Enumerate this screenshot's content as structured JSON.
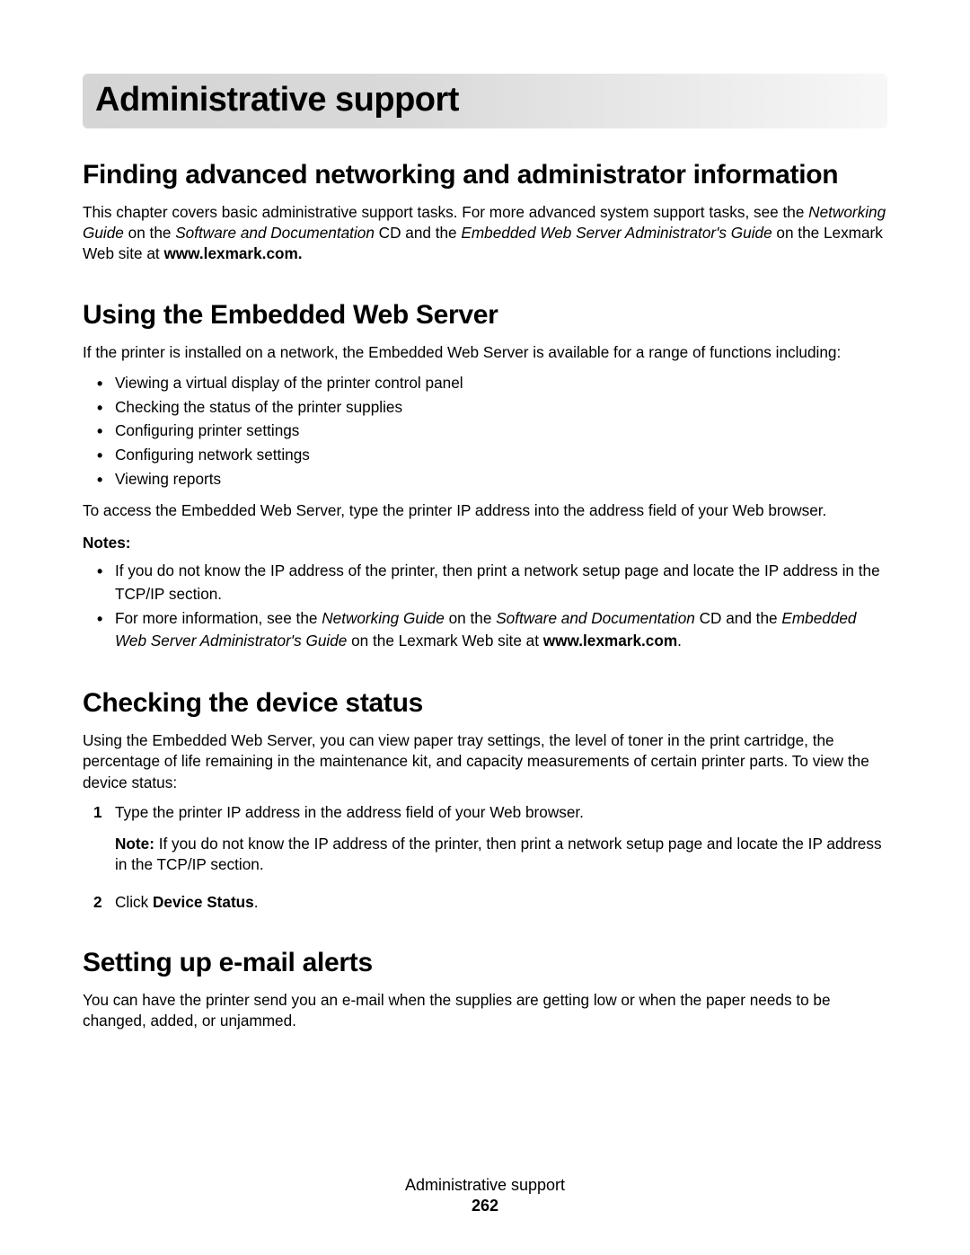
{
  "chapter": {
    "title": "Administrative support"
  },
  "section1": {
    "heading": "Finding advanced networking and administrator information",
    "p1a": "This chapter covers basic administrative support tasks. For more advanced system support tasks, see the ",
    "p1b": "Networking Guide",
    "p1c": " on the ",
    "p1d": "Software and Documentation",
    "p1e": " CD and the ",
    "p1f": "Embedded Web Server Administrator's Guide",
    "p1g": " on the Lexmark Web site at ",
    "p1h": "www.lexmark.com."
  },
  "section2": {
    "heading": "Using the Embedded Web Server",
    "intro": "If the printer is installed on a network, the Embedded Web Server is available for a range of functions including:",
    "bullets": [
      "Viewing a virtual display of the printer control panel",
      "Checking the status of the printer supplies",
      "Configuring printer settings",
      "Configuring network settings",
      "Viewing reports"
    ],
    "access": "To access the Embedded Web Server, type the printer IP address into the address field of your Web browser.",
    "notesLabel": "Notes:",
    "note1": "If you do not know the IP address of the printer, then print a network setup page and locate the IP address in the TCP/IP section.",
    "note2a": "For more information, see the ",
    "note2b": "Networking Guide",
    "note2c": " on the ",
    "note2d": "Software and Documentation",
    "note2e": " CD and the ",
    "note2f": "Embedded Web Server Administrator's Guide",
    "note2g": " on the Lexmark Web site at ",
    "note2h": "www.lexmark.com",
    "note2i": "."
  },
  "section3": {
    "heading": "Checking the device status",
    "intro": "Using the Embedded Web Server, you can view paper tray settings, the level of toner in the print cartridge, the percentage of life remaining in the maintenance kit, and capacity measurements of certain printer parts. To view the device status:",
    "step1": "Type the printer IP address in the address field of your Web browser.",
    "step1NoteLabel": "Note: ",
    "step1Note": "If you do not know the IP address of the printer, then print a network setup page and locate the IP address in the TCP/IP section.",
    "step2a": "Click ",
    "step2b": "Device Status",
    "step2c": "."
  },
  "section4": {
    "heading": "Setting up e-mail alerts",
    "intro": "You can have the printer send you an e-mail when the supplies are getting low or when the paper needs to be changed, added, or unjammed."
  },
  "footer": {
    "title": "Administrative support",
    "page": "262"
  }
}
